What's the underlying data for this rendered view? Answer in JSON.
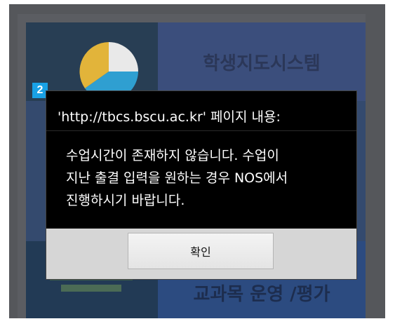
{
  "background_app": {
    "tile_top_title": "학생지도시스템",
    "tile_bottom_title": "교과목 운영 /평가"
  },
  "badge": {
    "label": "2",
    "color": "#19a1e6"
  },
  "dialog": {
    "title": "'http://tbcs.bscu.ac.kr' 페이지 내용:",
    "message_lines": [
      "수업시간이 존재하지 않습니다. 수업이",
      "지난 출결 입력을 원하는 경우 NOS에서",
      "진행하시기 바랍니다."
    ],
    "ok_button_label": "확인"
  }
}
